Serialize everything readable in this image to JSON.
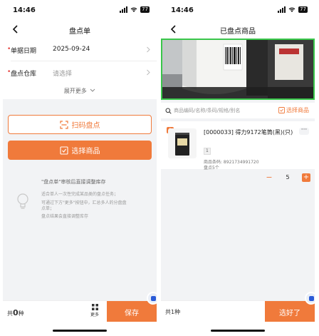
{
  "left": {
    "status_time": "14:46",
    "battery": "77",
    "nav_title": "盘点单",
    "form": {
      "date_label": "单据日期",
      "date_value": "2025-09-24",
      "warehouse_label": "盘点仓库",
      "warehouse_placeholder": "请选择"
    },
    "expand_label": "展开更多",
    "scan_button": "扫码盘点",
    "select_button": "选择商品",
    "tips": {
      "title": "\"盘点单\"审核后直接调整库存",
      "lines": [
        "适合单人一次性完成某品类的盘点任务；",
        "可通过下方\"更多\"按钮中，汇总多人的分盘盘",
        "点单；",
        "盘点结果会直接调整库存"
      ]
    },
    "bottom": {
      "count_prefix": "共",
      "count_value": "0",
      "count_suffix": "种",
      "more_label": "更多",
      "save_label": "保存"
    }
  },
  "right": {
    "status_time": "14:46",
    "battery": "77",
    "nav_title": "已盘点商品",
    "search_placeholder": "商品编码/名称/条码/规格/别名",
    "select_link": "选择商品",
    "item": {
      "index": "1",
      "name": "[0000033] 得力9172笔筒(黑)(只)",
      "unit": "1",
      "barcode": "商品条码: 8921734991720",
      "stock_label": "盘点5个",
      "quantity": "5"
    },
    "bottom": {
      "count_text": "共1种",
      "ok_label": "选好了"
    }
  },
  "colors": {
    "accent": "#f07a3b",
    "scan_frame": "#39c64a",
    "required": "#e64340"
  }
}
